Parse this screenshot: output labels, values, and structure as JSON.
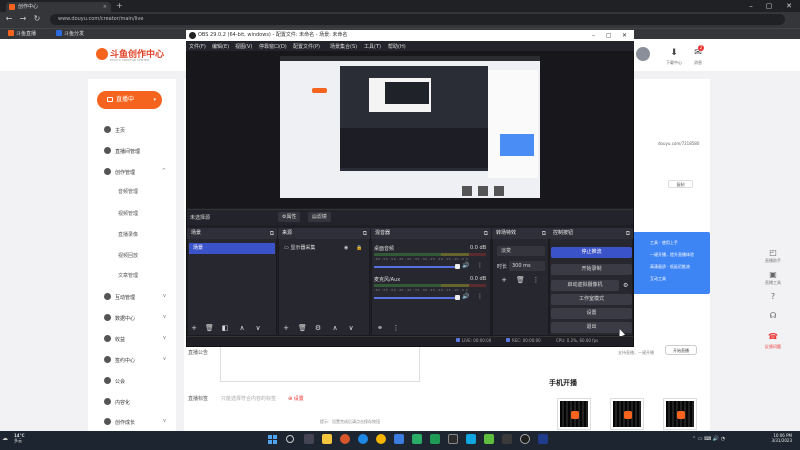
{
  "browser": {
    "tab_title": "创作中心",
    "new_tab": "+",
    "url": "www.douyu.com/creator/main/live",
    "minimize": "–",
    "maximize": "▢",
    "close": "✕",
    "bookmarks": [
      {
        "label": "斗鱼直播",
        "color": "#f5641e"
      },
      {
        "label": "斗鱼分发",
        "color": "#2a6cdd"
      }
    ]
  },
  "site": {
    "logo_text": "斗鱼创作中心",
    "logo_sub": "DOUYU CREATOR CENTER",
    "top_icons": [
      {
        "icon": "download-icon",
        "label": "下载中心",
        "glyph": "⬇"
      },
      {
        "icon": "message-icon",
        "label": "消息",
        "glyph": "✉"
      }
    ],
    "badge_count": "2",
    "live_button": "直播中",
    "menu": [
      {
        "label": "主页",
        "chevron": ""
      },
      {
        "label": "直播间管理",
        "chevron": ""
      },
      {
        "label": "创作管理",
        "chevron": "^"
      },
      {
        "label": "互动管理",
        "chevron": "v"
      },
      {
        "label": "数据中心",
        "chevron": "v"
      },
      {
        "label": "收益",
        "chevron": "v"
      },
      {
        "label": "签约中心",
        "chevron": "v"
      },
      {
        "label": "公会",
        "chevron": ""
      },
      {
        "label": "内容化",
        "chevron": ""
      },
      {
        "label": "创作成长",
        "chevron": "v"
      }
    ],
    "submenu": [
      "音频管理",
      "视频管理",
      "直播录像",
      "视频回放",
      "文章管理"
    ],
    "rc_link": "douyu.com/7218580",
    "rc_button": "复制",
    "blue_card": [
      "工具 · 使用上手",
      "一键开播，提升直播体验",
      "高清画质 · 低延迟推流",
      "互动工具"
    ],
    "start_button": "开始直播",
    "tiny_note": "支持直播，一键开播",
    "phone_title": "手机开播",
    "notice_label": "直播公告",
    "tag_label": "直播标签",
    "tag_hint": "只能选择符合内容的标签",
    "tag_set": "⊕ 设置",
    "bottom_hint": "提示：设置完成后请点击保存按钮",
    "float_items": [
      {
        "glyph": "◰",
        "label": "直播助手",
        "red": false
      },
      {
        "glyph": "▣",
        "label": "直播工具",
        "red": false
      },
      {
        "glyph": "?",
        "label": "",
        "red": false
      },
      {
        "glyph": "☊",
        "label": "",
        "red": false
      },
      {
        "glyph": "☎",
        "label": "反馈问题",
        "red": true
      }
    ]
  },
  "obs": {
    "title": "OBS 29.0.2 (64-bit, windows) - 配置文件: 未命名 - 场景: 未命名",
    "menu": [
      "文件(F)",
      "编辑(E)",
      "视图(V)",
      "停靠窗口(D)",
      "配置文件(P)",
      "场景集合(S)",
      "工具(T)",
      "帮助(H)"
    ],
    "no_source": "未选择源",
    "tab_properties": "⚙属性",
    "tab_filters": "▤滤镜",
    "docks": {
      "scenes": "场景",
      "sources": "来源",
      "mixer": "混音器",
      "transitions": "转场特效",
      "controls": "控制按钮"
    },
    "scene_item": "场景",
    "source_item": "显示器采集",
    "mixer": [
      {
        "name": "桌面音频",
        "db": "0.0 dB"
      },
      {
        "name": "麦克风/Aux",
        "db": "0.0 dB"
      }
    ],
    "meter_scale": "-60 -55 -50 -45 -40 -35 -30 -25 -20 -15 -10 -5 0",
    "transition": "淡变",
    "duration_label": "时长",
    "duration": "300 ms",
    "controls": [
      "停止推流",
      "开始录制",
      "启动虚拟摄像机",
      "工作室模式",
      "设置",
      "退出"
    ],
    "status": {
      "live": "LIVE: 00:00:00",
      "rec": "REC: 00:00:00",
      "cpu": "CPU: 0.2%, 60.00 fps"
    }
  },
  "taskbar": {
    "weather_temp": "14°C",
    "weather_desc": "多云",
    "time": "10:06 PM",
    "date": "3/31/2023"
  }
}
